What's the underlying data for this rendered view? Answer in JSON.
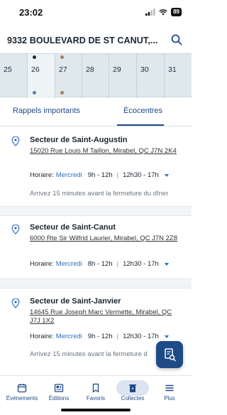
{
  "status": {
    "time": "23:02",
    "battery": "89"
  },
  "header": {
    "address": "9332 BOULEVARD DE ST CANUT,..."
  },
  "calendar": {
    "days": [
      "25",
      "26",
      "27",
      "28",
      "29",
      "30",
      "31"
    ],
    "colors": {
      "dark_dot": "#2b2b2b",
      "brown_dot": "#b07a55",
      "blue_dot": "#5a7fb5"
    }
  },
  "tabs": {
    "reminders": "Rappels importants",
    "ecocentres": "Écocentres"
  },
  "cards": [
    {
      "title": "Secteur de Saint-Augustin",
      "address": "15020 Rue Louis M Taillon, Mirabel, QC J7N 2K4",
      "hours_label": "Horaire:",
      "day": "Mercredi",
      "slot1": "9h - 12h",
      "slot2": "12h30 - 17h",
      "note": "Arrivez 15 minutes avant la fermeture du dîner"
    },
    {
      "title": "Secteur de Saint-Canut",
      "address": "6000 Rte Sir Wilfrid Laurier, Mirabel, QC J7N 2Z8",
      "hours_label": "Horaire:",
      "day": "Mercredi",
      "slot1": "8h - 12h",
      "slot2": "12h30 - 17h"
    },
    {
      "title": "Secteur de Saint-Janvier",
      "address": "14645 Rue Joseph Marc Vermette, Mirabel, QC J7J 1X2",
      "hours_label": "Horaire:",
      "day": "Mercredi",
      "slot1": "9h - 12h",
      "slot2": "12h30 - 17h",
      "note": "Arrivez 15 minutes avant la fermeture d"
    }
  ],
  "nav": {
    "events": "Événements",
    "editions": "Éditions",
    "favorites": "Favoris",
    "collections": "Collectes",
    "more": "Plus"
  },
  "colors": {
    "accent": "#1e4a86",
    "link": "#2b6fbf"
  }
}
